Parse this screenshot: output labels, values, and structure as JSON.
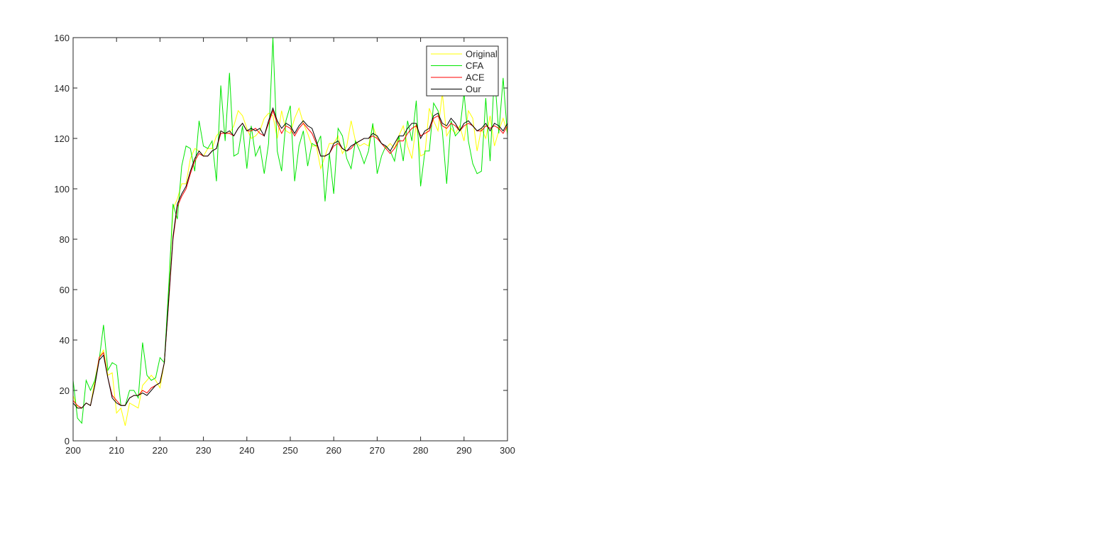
{
  "chart_data": {
    "type": "line",
    "title": "",
    "xlabel": "",
    "ylabel": "",
    "xlim": [
      200,
      300
    ],
    "ylim": [
      0,
      160
    ],
    "x_ticks": [
      200,
      210,
      220,
      230,
      240,
      250,
      260,
      270,
      280,
      290,
      300
    ],
    "y_ticks": [
      0,
      20,
      40,
      60,
      80,
      100,
      120,
      140,
      160
    ],
    "x_tick_labels": [
      "200",
      "210",
      "220",
      "230",
      "240",
      "250",
      "260",
      "270",
      "280",
      "290",
      "300"
    ],
    "y_tick_labels": [
      "0",
      "20",
      "40",
      "60",
      "80",
      "100",
      "120",
      "140",
      "160"
    ],
    "grid": false,
    "legend_position": "top-right",
    "x_start": 200,
    "x_step": 1,
    "series": [
      {
        "name": "Original",
        "color": "#ffff00",
        "values": [
          18,
          13,
          13,
          15,
          14,
          24,
          33,
          36,
          26,
          27,
          11,
          13,
          6,
          15,
          14,
          13,
          22,
          24,
          26,
          24,
          21,
          31,
          60,
          92,
          96,
          102,
          102,
          112,
          116,
          115,
          113,
          116,
          116,
          121,
          123,
          122,
          122,
          125,
          131,
          129,
          124,
          120,
          121,
          123,
          128,
          130,
          129,
          120,
          131,
          123,
          122,
          128,
          132,
          126,
          122,
          117,
          117,
          108,
          113,
          118,
          118,
          121,
          114,
          117,
          127,
          119,
          117,
          118,
          117,
          125,
          120,
          118,
          116,
          118,
          116,
          121,
          125,
          117,
          112,
          126,
          113,
          114,
          132,
          127,
          123,
          138,
          121,
          124,
          122,
          125,
          119,
          131,
          128,
          115,
          124,
          120,
          129,
          117,
          123,
          128,
          122
        ]
      },
      {
        "name": "CFA",
        "color": "#00e600",
        "values": [
          24,
          9,
          7,
          24,
          20,
          24,
          32,
          46,
          28,
          31,
          30,
          14,
          14,
          20,
          20,
          17,
          39,
          26,
          24,
          25,
          33,
          31,
          61,
          94,
          88,
          109,
          117,
          116,
          107,
          127,
          117,
          116,
          119,
          103,
          141,
          119,
          146,
          113,
          114,
          125,
          108,
          125,
          113,
          117,
          106,
          118,
          160,
          115,
          107,
          127,
          133,
          103,
          117,
          123,
          109,
          118,
          117,
          121,
          95,
          114,
          98,
          124,
          121,
          112,
          108,
          119,
          115,
          110,
          115,
          126,
          106,
          113,
          117,
          115,
          111,
          121,
          111,
          127,
          119,
          135,
          101,
          115,
          115,
          134,
          131,
          123,
          102,
          127,
          121,
          123,
          138,
          119,
          110,
          106,
          107,
          136,
          111,
          146,
          122,
          144,
          121
        ]
      },
      {
        "name": "ACE",
        "color": "#ff0000",
        "values": [
          16,
          14,
          13,
          15,
          14,
          22,
          33,
          35,
          25,
          18,
          16,
          14,
          14,
          17,
          18,
          18,
          20,
          19,
          21,
          22,
          23,
          31,
          55,
          80,
          93,
          97,
          100,
          106,
          111,
          114,
          113,
          113,
          115,
          116,
          122,
          122,
          122,
          121,
          124,
          126,
          123,
          123,
          124,
          122,
          121,
          126,
          131,
          126,
          122,
          125,
          124,
          121,
          124,
          126,
          124,
          122,
          118,
          113,
          113,
          114,
          117,
          118,
          116,
          115,
          116,
          118,
          119,
          120,
          120,
          121,
          120,
          118,
          116,
          114,
          116,
          119,
          119,
          122,
          124,
          125,
          121,
          122,
          123,
          128,
          129,
          125,
          124,
          126,
          125,
          123,
          125,
          126,
          125,
          123,
          123,
          125,
          124,
          125,
          124,
          122,
          125
        ]
      },
      {
        "name": "Our",
        "color": "#000000",
        "values": [
          15,
          13,
          13,
          15,
          14,
          22,
          32,
          34,
          25,
          17,
          15,
          14,
          14,
          17,
          18,
          18,
          19,
          18,
          20,
          22,
          23,
          31,
          56,
          81,
          94,
          98,
          101,
          107,
          112,
          115,
          113,
          113,
          115,
          116,
          123,
          122,
          123,
          121,
          124,
          126,
          123,
          124,
          123,
          124,
          121,
          127,
          132,
          127,
          124,
          126,
          125,
          122,
          125,
          127,
          125,
          124,
          119,
          113,
          113,
          114,
          118,
          119,
          116,
          115,
          117,
          118,
          119,
          120,
          120,
          122,
          121,
          118,
          117,
          115,
          118,
          121,
          121,
          124,
          126,
          126,
          120,
          123,
          124,
          129,
          130,
          126,
          125,
          128,
          126,
          123,
          126,
          127,
          125,
          123,
          124,
          126,
          123,
          126,
          125,
          123,
          126
        ]
      }
    ]
  }
}
